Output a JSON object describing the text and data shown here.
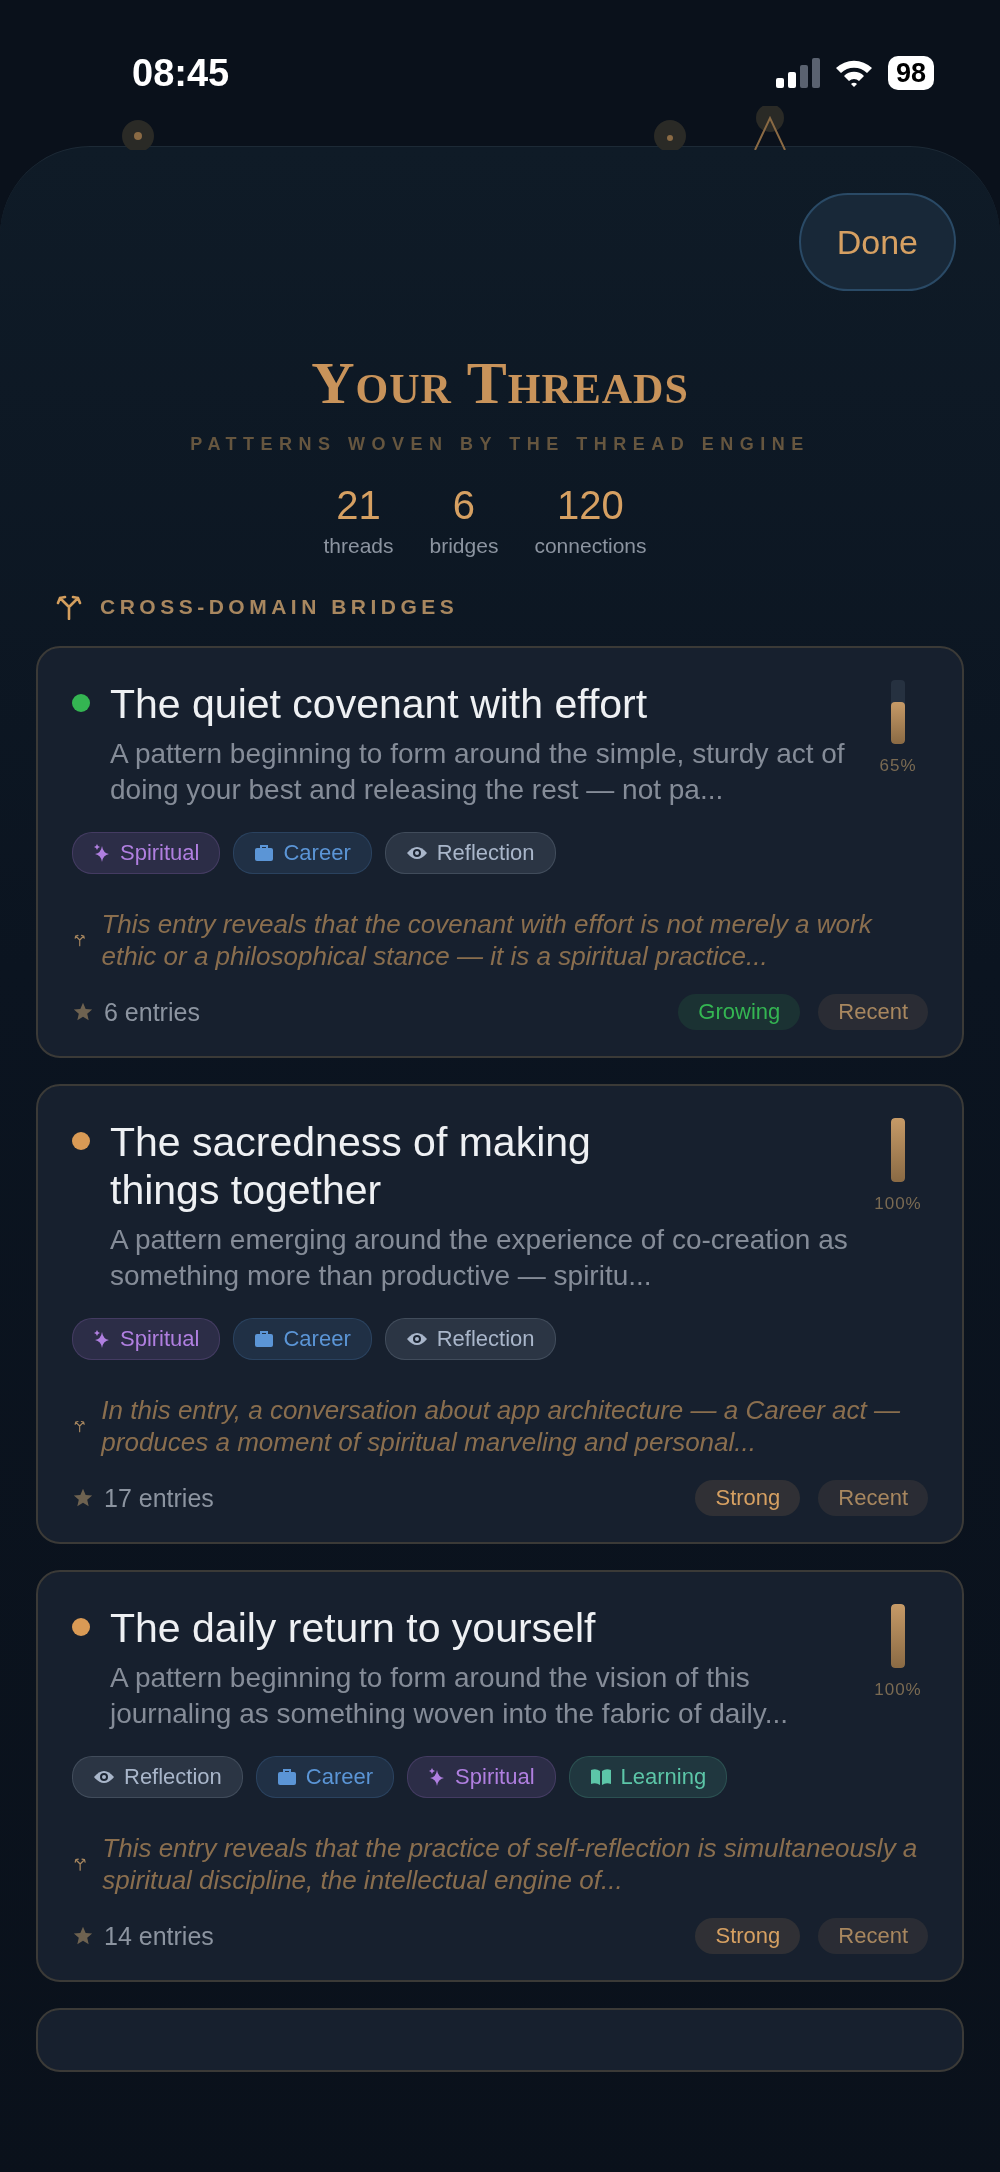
{
  "status_bar": {
    "time": "08:45",
    "battery": "98"
  },
  "done_button": "Done",
  "title": "Your Threads",
  "subtitle": "PATTERNS WOVEN BY THE THREAD ENGINE",
  "stats": [
    {
      "value": "21",
      "label": "threads"
    },
    {
      "value": "6",
      "label": "bridges"
    },
    {
      "value": "120",
      "label": "connections"
    }
  ],
  "section_title": "CROSS-DOMAIN BRIDGES",
  "cards": [
    {
      "title": "The quiet covenant with effort",
      "color": "#34b552",
      "level": 0.65,
      "percent": "65%",
      "description": "A pattern beginning to form around the simple, sturdy act of doing your best and releasing the rest — not pa...",
      "tags": [
        {
          "kind": "sparkle",
          "label": "Spiritual",
          "color": "#b07fe0"
        },
        {
          "kind": "briefcase",
          "label": "Career",
          "color": "#5b95d6"
        },
        {
          "kind": "eye",
          "label": "Reflection",
          "color": "#a9b6ca"
        }
      ],
      "insight": "This entry reveals that the covenant with effort is not merely a work ethic or a philosophical stance — it is a spiritual practice...",
      "entries": "6 entries",
      "badges": [
        {
          "label": "Growing",
          "color": "#34b552"
        },
        {
          "label": "Recent",
          "color": "#a8875f"
        }
      ]
    },
    {
      "title": "The sacredness of making things together",
      "color": "#d99a55",
      "level": 1,
      "percent": "100%",
      "description": "A pattern emerging around the experience of co-creation as something more than productive — spiritu...",
      "tags": [
        {
          "kind": "sparkle",
          "label": "Spiritual",
          "color": "#b07fe0"
        },
        {
          "kind": "briefcase",
          "label": "Career",
          "color": "#5b95d6"
        },
        {
          "kind": "eye",
          "label": "Reflection",
          "color": "#a9b6ca"
        }
      ],
      "insight": "In this entry, a conversation about app architecture — a Career act — produces a moment of spiritual marveling and personal...",
      "entries": "17 entries",
      "badges": [
        {
          "label": "Strong",
          "color": "#d6a062"
        },
        {
          "label": "Recent",
          "color": "#a8875f"
        }
      ]
    },
    {
      "title": "The daily return to yourself",
      "color": "#d99a55",
      "level": 1,
      "percent": "100%",
      "description": "A pattern beginning to form around the vision of this journaling as something woven into the fabric of daily...",
      "tags": [
        {
          "kind": "eye",
          "label": "Reflection",
          "color": "#a9b6ca"
        },
        {
          "kind": "briefcase",
          "label": "Career",
          "color": "#5b95d6"
        },
        {
          "kind": "sparkle",
          "label": "Spiritual",
          "color": "#b07fe0"
        },
        {
          "kind": "book",
          "label": "Learning",
          "color": "#5cc6a8"
        }
      ],
      "insight": "This entry reveals that the practice of self-reflection is simultaneously a spiritual discipline, the intellectual engine of...",
      "entries": "14 entries",
      "badges": [
        {
          "label": "Strong",
          "color": "#d6a062"
        },
        {
          "label": "Recent",
          "color": "#a8875f"
        }
      ]
    }
  ]
}
